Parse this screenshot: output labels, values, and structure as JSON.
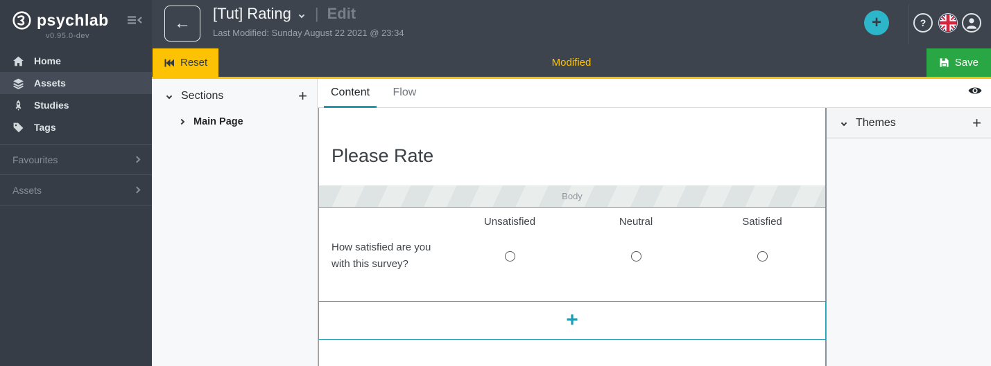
{
  "sidebar": {
    "logo_text": "psychlab",
    "version": "v0.95.0-dev",
    "items": [
      {
        "label": "Home",
        "icon": "home-icon",
        "active": false
      },
      {
        "label": "Assets",
        "icon": "layers-icon",
        "active": true
      },
      {
        "label": "Studies",
        "icon": "rocket-icon",
        "active": false
      },
      {
        "label": "Tags",
        "icon": "tag-icon",
        "active": false
      }
    ],
    "groups": [
      {
        "label": "Favourites"
      },
      {
        "label": "Assets"
      }
    ]
  },
  "header": {
    "title": "[Tut] Rating",
    "separator": "|",
    "mode": "Edit",
    "last_modified": "Last Modified: Sunday August 22 2021 @ 23:34",
    "add_label": "+",
    "help_label": "?"
  },
  "toolbar": {
    "reset_label": "Reset",
    "status": "Modified",
    "save_label": "Save"
  },
  "sections_panel": {
    "title": "Sections",
    "add_label": "+",
    "items": [
      {
        "label": "Main Page"
      }
    ]
  },
  "tabs": [
    {
      "label": "Content",
      "active": true
    },
    {
      "label": "Flow",
      "active": false
    }
  ],
  "canvas": {
    "heading": "Please Rate",
    "body_placeholder": "Body",
    "rating_table": {
      "columns": [
        "Unsatisfied",
        "Neutral",
        "Satisfied"
      ],
      "rows": [
        {
          "question": "How satisfied are you with this survey?"
        }
      ]
    },
    "add_label": "+"
  },
  "themes_panel": {
    "title": "Themes",
    "add_label": "+"
  },
  "colors": {
    "accent_teal": "#1f9fb5",
    "accent_teal_bright": "#2db5c9",
    "warning_yellow": "#fcc203",
    "success_green": "#2aa745",
    "dark_chrome": "#3d444d",
    "sidebar_dark": "#373d46"
  }
}
